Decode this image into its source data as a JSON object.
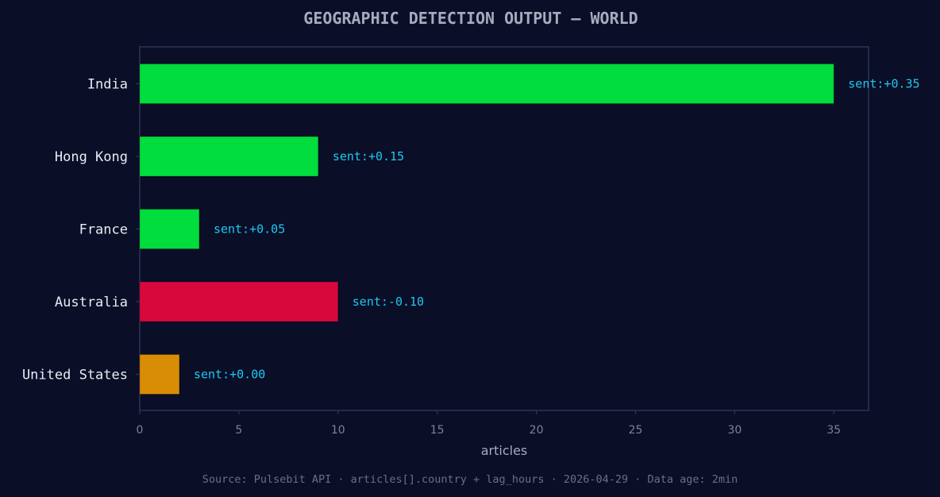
{
  "chart_data": {
    "type": "bar",
    "orientation": "horizontal",
    "title": "GEOGRAPHIC DETECTION OUTPUT — WORLD",
    "xlabel": "articles",
    "ylabel": "",
    "xlim": [
      0,
      36.75
    ],
    "xticks": [
      0,
      5,
      10,
      15,
      20,
      25,
      30,
      35
    ],
    "grid": false,
    "categories": [
      "India",
      "Hong Kong",
      "France",
      "Australia",
      "United States"
    ],
    "values": [
      35,
      9,
      3,
      10,
      2
    ],
    "data_labels": [
      "sent:+0.35",
      "sent:+0.15",
      "sent:+0.05",
      "sent:-0.10",
      "sent:+0.00"
    ],
    "colors": [
      "#00dd3c",
      "#00dd3c",
      "#00dd3c",
      "#d8083c",
      "#d98c06"
    ]
  },
  "footer": {
    "source": "Source: Pulsebit API · articles[].country + lag_hours · 2026-04-29 · Data age: 2min"
  },
  "theme": {
    "background": "#0a0e27",
    "axis_color": "#2e3350",
    "positive_color": "#00dd3c",
    "negative_color": "#d8083c",
    "neutral_color": "#d98c06",
    "label_color": "#1ec8f0"
  }
}
